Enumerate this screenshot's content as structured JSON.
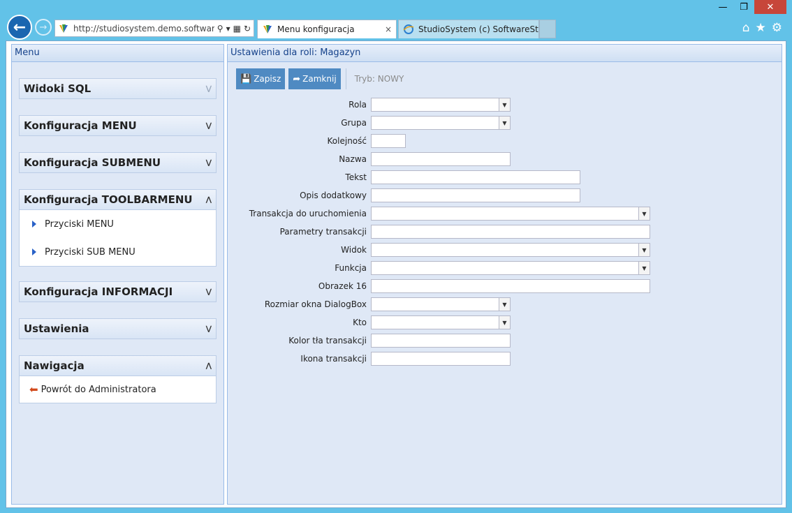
{
  "browser": {
    "address": "http://studiosystem.demo.softwar...",
    "tabs": [
      {
        "label": "Menu konfiguracja",
        "close": "×"
      },
      {
        "label": "StudioSystem (c) SoftwareStud..."
      }
    ],
    "controls": {
      "minimize": "—",
      "restore": "❐",
      "close": "✕"
    },
    "icons": [
      "home-icon",
      "star-icon",
      "gear-icon"
    ]
  },
  "left_panel": {
    "title": "Menu",
    "sections": [
      {
        "title": "Widoki SQL",
        "expanded": false
      },
      {
        "title": "Konfiguracja MENU",
        "expanded": false
      },
      {
        "title": "Konfiguracja SUBMENU",
        "expanded": false
      },
      {
        "title": "Konfiguracja TOOLBARMENU",
        "expanded": true,
        "items": [
          "Przyciski MENU",
          "Przyciski SUB MENU"
        ]
      },
      {
        "title": "Konfiguracja INFORMACJI",
        "expanded": false
      },
      {
        "title": "Ustawienia",
        "expanded": false
      },
      {
        "title": "Nawigacja",
        "expanded": true,
        "items": [
          "Powrót do Administratora"
        ]
      }
    ]
  },
  "right_panel": {
    "title": "Ustawienia dla roli: Magazyn",
    "toolbar": {
      "save": "Zapisz",
      "close": "Zamknij",
      "mode": "Tryb: NOWY"
    },
    "fields": [
      {
        "label": "Rola",
        "value": ""
      },
      {
        "label": "Grupa",
        "value": ""
      },
      {
        "label": "Kolejność",
        "value": ""
      },
      {
        "label": "Nazwa",
        "value": ""
      },
      {
        "label": "Tekst",
        "value": ""
      },
      {
        "label": "Opis dodatkowy",
        "value": ""
      },
      {
        "label": "Transakcja do uruchomienia",
        "value": ""
      },
      {
        "label": "Parametry transakcji",
        "value": ""
      },
      {
        "label": "Widok",
        "value": ""
      },
      {
        "label": "Funkcja",
        "value": ""
      },
      {
        "label": "Obrazek 16",
        "value": ""
      },
      {
        "label": "Rozmiar okna DialogBox",
        "value": ""
      },
      {
        "label": "Kto",
        "value": ""
      },
      {
        "label": "Kolor tła transakcji",
        "value": ""
      },
      {
        "label": "Ikona transakcji",
        "value": ""
      }
    ]
  }
}
